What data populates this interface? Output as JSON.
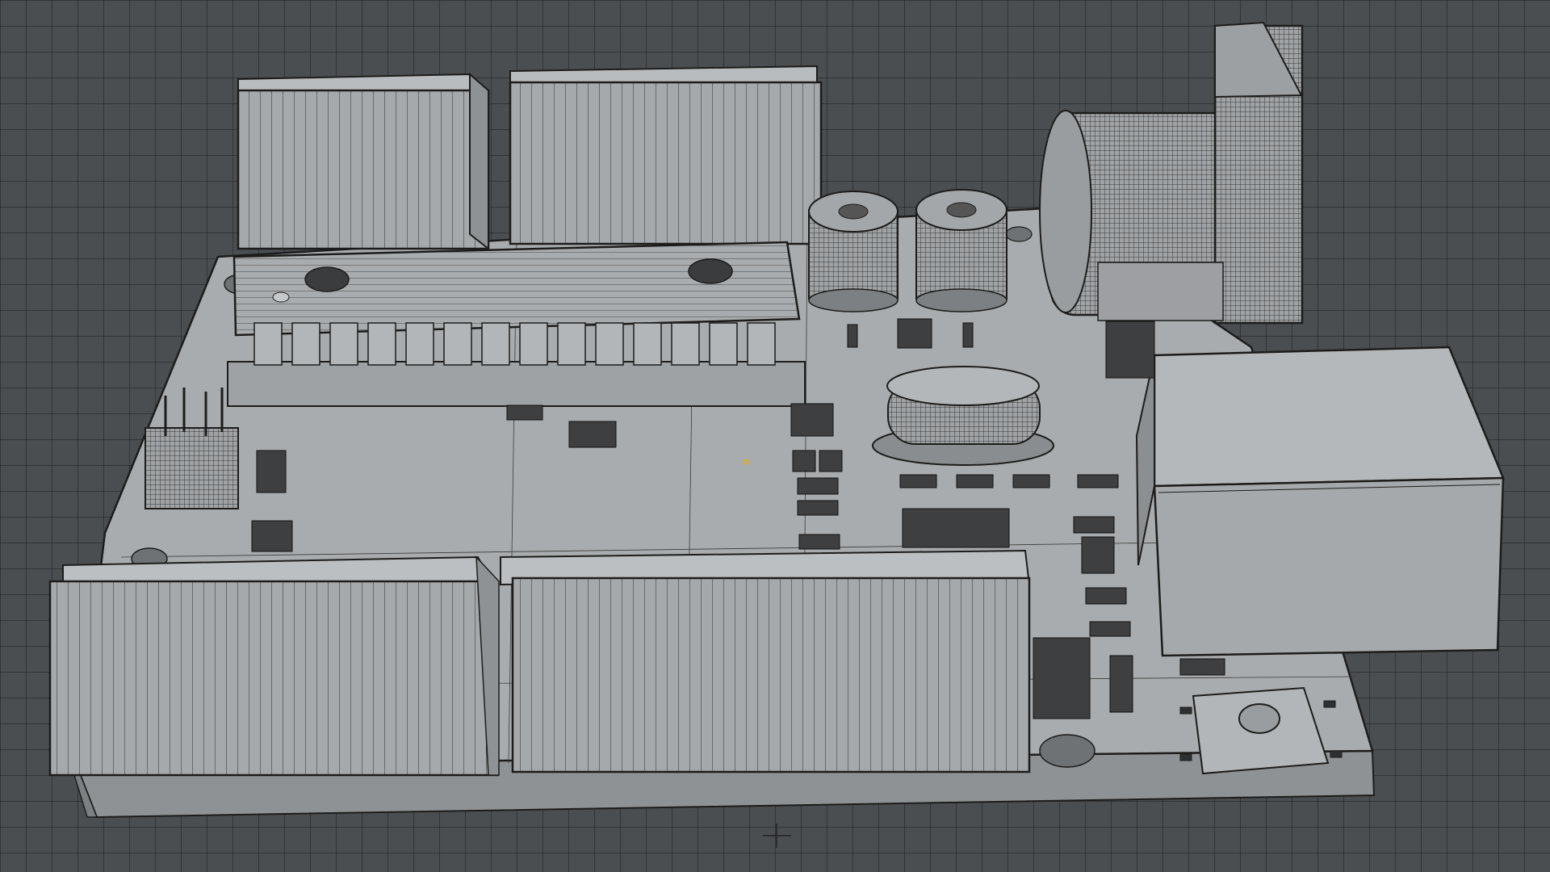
{
  "viewport": {
    "mode": "wireframe-shaded",
    "background_color": "#4b4e51",
    "grid_color": "#2f3133",
    "mesh_fill": "#a4a7a9",
    "mesh_fill_light": "#b4b7b9",
    "mesh_fill_dark": "#8e9193",
    "wire_color": "#1c1c1c",
    "origin_marker_color": "#e8b000"
  },
  "model": {
    "object": "pcb-board-assembly",
    "components": [
      "pin-header-top-left",
      "pin-header-top-right",
      "pin-header-bottom-left",
      "pin-header-bottom-right",
      "dip-ic-chip",
      "electrolytic-capacitor-1",
      "electrolytic-capacitor-2",
      "crystal-oscillator",
      "usb-connector",
      "power-jack",
      "reset-button",
      "icsp-header",
      "smd-components"
    ]
  }
}
